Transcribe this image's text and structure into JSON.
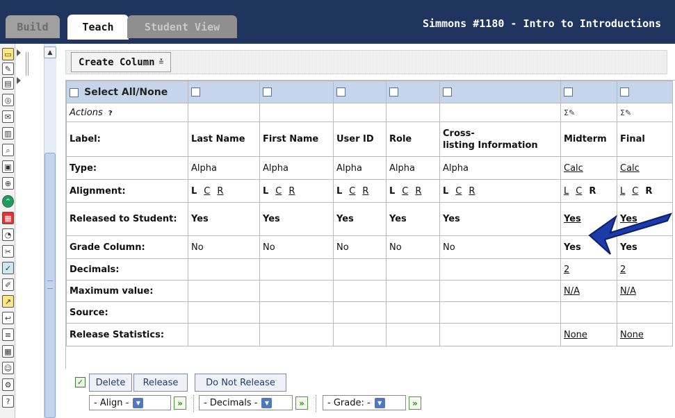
{
  "tabs": {
    "build": "Build",
    "teach": "Teach",
    "student_view": "Student View"
  },
  "course_title": "Simmons #1180 - Intro to Introductions",
  "toolbar": {
    "create_column": "Create Column"
  },
  "grid": {
    "select_all": "Select All/None",
    "actions_label": "Actions",
    "actions_help": "?",
    "columns": [
      "Last Name",
      "First Name",
      "User ID",
      "Role",
      "Cross-listing Information",
      "Midterm",
      "Final"
    ],
    "row_labels": {
      "label": "Label:",
      "type": "Type:",
      "alignment": "Alignment:",
      "released": "Released to Student:",
      "grade_column": "Grade Column:",
      "decimals": "Decimals:",
      "maximum": "Maximum value:",
      "source": "Source:",
      "release_stats": "Release Statistics:"
    },
    "label_values": [
      "Last Name",
      "First Name",
      "User ID",
      "Role",
      "Cross-",
      "listing Information",
      "Midterm",
      "Final"
    ],
    "type_values": [
      "Alpha",
      "Alpha",
      "Alpha",
      "Alpha",
      "Alpha",
      "Calc",
      "Calc"
    ],
    "align_letters": [
      "L",
      "C",
      "R"
    ],
    "released_values": [
      "Yes",
      "Yes",
      "Yes",
      "Yes",
      "Yes",
      "Yes",
      "Yes"
    ],
    "grade_values": [
      "No",
      "No",
      "No",
      "No",
      "No",
      "Yes",
      "Yes"
    ],
    "decimals_values": [
      "2",
      "2"
    ],
    "maximum_values": [
      "N/A",
      "N/A"
    ],
    "release_stats_values": [
      "None",
      "None"
    ],
    "sigma_icon": "Σ"
  },
  "footer": {
    "delete": "Delete",
    "release": "Release",
    "do_not_release": "Do Not Release",
    "align_select": "- Align -",
    "decimals_select": "- Decimals -",
    "grade_select": "- Grade: -"
  },
  "colors": {
    "topbar": "#1f3560",
    "header_row": "#c7d5ec",
    "arrow": "#1c3aa8"
  }
}
